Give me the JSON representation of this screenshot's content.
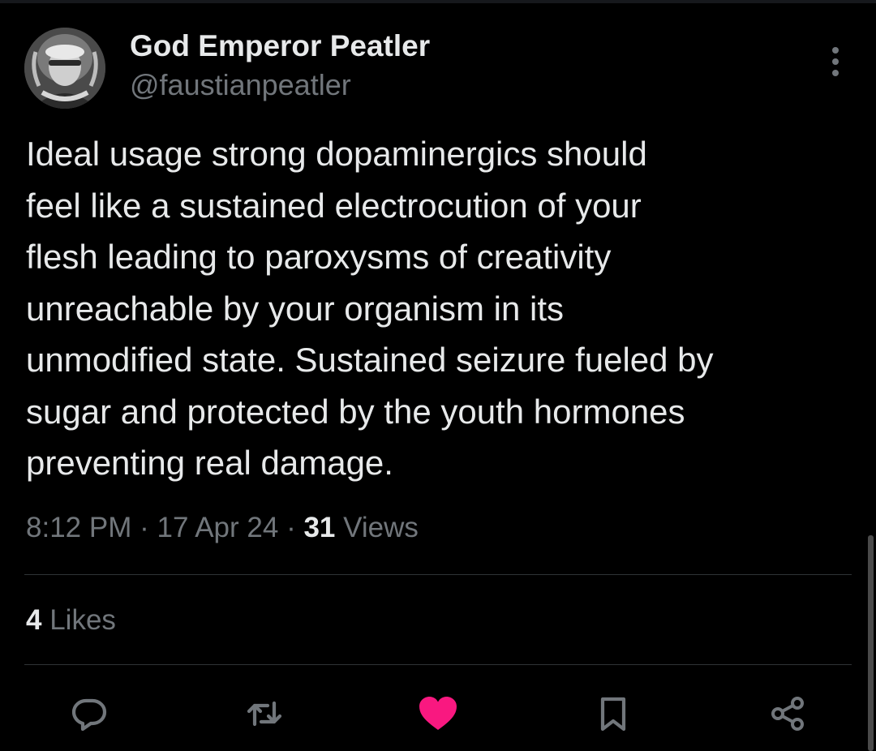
{
  "author": {
    "display_name": "God Emperor Peatler",
    "handle": "@faustianpeatler"
  },
  "tweet": {
    "text": "Ideal usage strong dopaminergics should\nfeel like a sustained electrocution of your\nflesh leading to paroxysms of creativity\nunreachable by your organism in its\nunmodified state. Sustained seizure fueled by\nsugar and protected by the youth hormones\npreventing real damage.",
    "time": "8:12 PM",
    "separator": "·",
    "date": "17 Apr 24",
    "views_count": "31",
    "views_label": "Views"
  },
  "engagement": {
    "likes_count": "4",
    "likes_label": "Likes"
  },
  "actions": {
    "reply_icon": "reply-bubble-icon",
    "retweet_icon": "retweet-arrows-icon",
    "like_icon": "heart-filled-icon",
    "bookmark_icon": "bookmark-icon",
    "share_icon": "share-nodes-icon"
  },
  "colors": {
    "background": "#000000",
    "primary_text": "#e7e9ea",
    "secondary_text": "#71767b",
    "divider": "#2f3336",
    "like_active": "#f91880",
    "icon": "#71767b"
  }
}
